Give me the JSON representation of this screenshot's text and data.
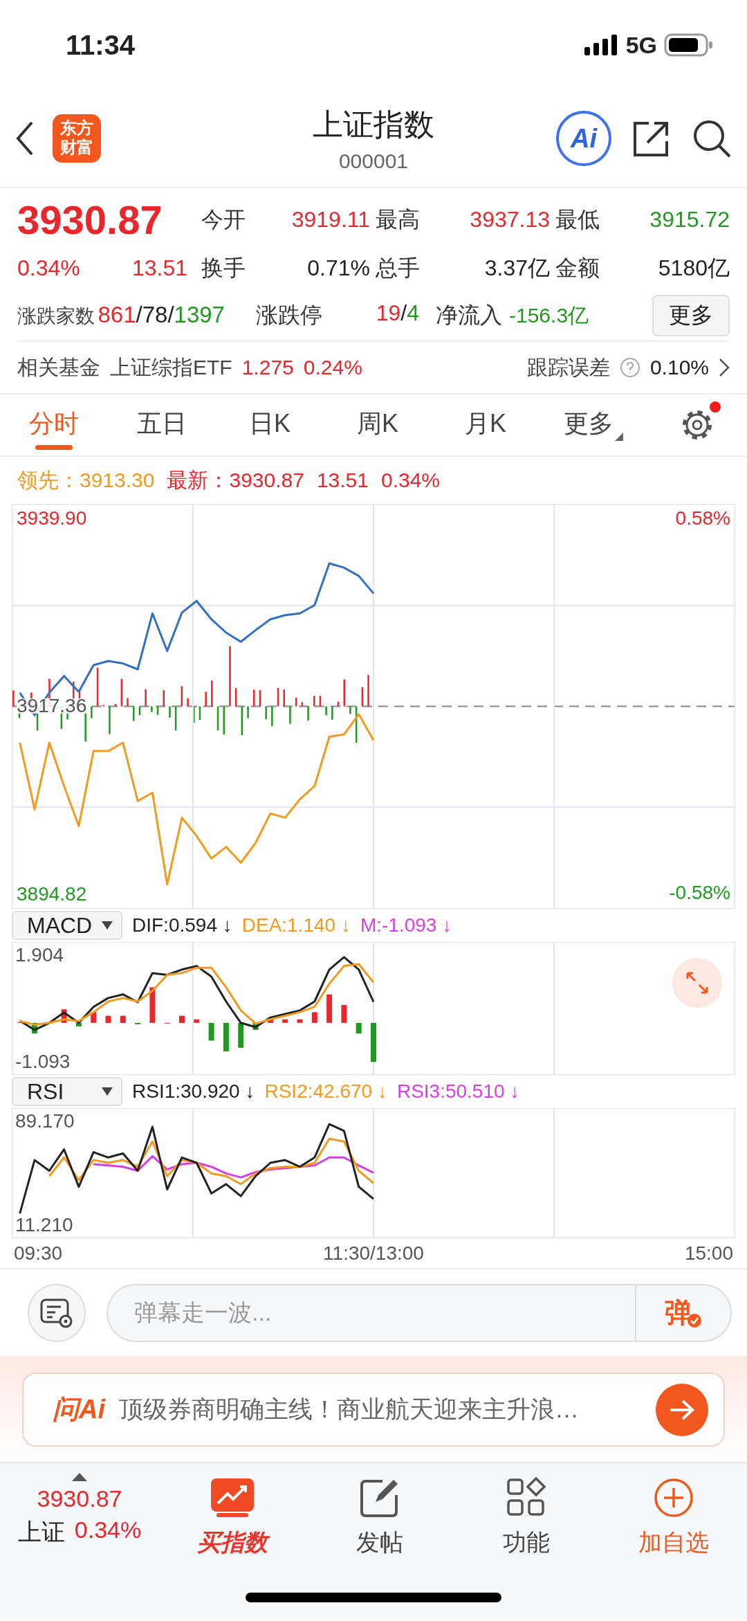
{
  "status_bar": {
    "time": "11:34",
    "network": "5G"
  },
  "header": {
    "logo": "东方财富",
    "title": "上证指数",
    "code": "000001",
    "ai_label": "Ai"
  },
  "quote": {
    "price": "3930.87",
    "change_pct": "0.34%",
    "change": "13.51",
    "color": "#e8262b",
    "stats": [
      {
        "label": "今开",
        "value": "3919.11",
        "color": "#e8262b"
      },
      {
        "label": "最高",
        "value": "3937.13",
        "color": "#e8262b"
      },
      {
        "label": "最低",
        "value": "3915.72",
        "color": "#1f9a1f"
      },
      {
        "label": "换手",
        "value": "0.71%",
        "color": "#222222"
      },
      {
        "label": "总手",
        "value": "3.37亿",
        "color": "#222222"
      },
      {
        "label": "金额",
        "value": "5180亿",
        "color": "#222222"
      }
    ],
    "breadth": {
      "label": "涨跌家数",
      "parts": [
        {
          "text": "861",
          "color": "#e8262b"
        },
        {
          "text": "/78/",
          "color": "#222222"
        },
        {
          "text": "1397",
          "color": "#1f9a1f"
        }
      ]
    },
    "limit": {
      "label": "涨跌停",
      "parts": [
        {
          "text": "19",
          "color": "#e8262b"
        },
        {
          "text": "/",
          "color": "#222222"
        },
        {
          "text": "4",
          "color": "#1f9a1f"
        }
      ]
    },
    "net_inflow": {
      "label": "净流入",
      "value": "-156.3亿",
      "color": "#1f9a1f"
    },
    "more_button": "更多"
  },
  "fund": {
    "label": "相关基金",
    "name": "上证综指ETF",
    "price": "1.275",
    "change": "0.24%",
    "tracking_label": "跟踪误差",
    "tracking_value": "0.10%"
  },
  "tabs": [
    {
      "label": "分时",
      "selected": true,
      "kind": "tab"
    },
    {
      "label": "五日",
      "selected": false,
      "kind": "tab"
    },
    {
      "label": "日K",
      "selected": false,
      "kind": "tab"
    },
    {
      "label": "周K",
      "selected": false,
      "kind": "tab"
    },
    {
      "label": "月K",
      "selected": false,
      "kind": "tab"
    },
    {
      "label": "更多",
      "selected": false,
      "kind": "menu"
    }
  ],
  "settings": {
    "notification_dot": true
  },
  "legend": [
    {
      "text": "领先：3913.30",
      "color": "#f39a1e"
    },
    {
      "text": "最新：3930.87",
      "color": "#e8262b"
    },
    {
      "text": "13.51",
      "color": "#e8262b"
    },
    {
      "text": "0.34%",
      "color": "#e8262b"
    }
  ],
  "price_chart": {
    "right_labels": [
      {
        "text": "0.58%",
        "color": "#e8262b"
      },
      {
        "text": "-0.58%",
        "color": "#1f9a1f"
      }
    ],
    "chart_data": {
      "type": "line",
      "categories": [
        null,
        null,
        null,
        null,
        null,
        null,
        null,
        null,
        null,
        null,
        null,
        null,
        null,
        null,
        null,
        null,
        null,
        null,
        null,
        null,
        null,
        null,
        null,
        null,
        null,
        null,
        null,
        null,
        null,
        null,
        null,
        null,
        null,
        null,
        null,
        null,
        null,
        null,
        null,
        null,
        null,
        null,
        null,
        null,
        null,
        null,
        null,
        null,
        null
      ],
      "series": [
        {
          "color": "#3370c4",
          "values": [
            3919.0,
            3916.3,
            3919.0,
            3921.0,
            3919.1,
            3922.3,
            3922.8,
            3922.5,
            3921.8,
            3928.5,
            3924.0,
            3928.6,
            3930.0,
            3927.8,
            3926.2,
            3925.1,
            3926.5,
            3927.8,
            3928.3,
            3928.5,
            3929.5,
            3934.5,
            3934.0,
            3933.0,
            3930.9,
            null,
            null,
            null,
            null,
            null,
            null,
            null,
            null,
            null,
            null,
            null,
            null,
            null,
            null,
            null,
            null,
            null,
            null,
            null,
            null,
            null,
            null,
            null,
            null
          ]
        },
        {
          "color": "#f39a1e",
          "values": [
            3913.0,
            3905.0,
            3913.0,
            3907.8,
            3903.0,
            3912.0,
            3912.0,
            3913.0,
            3906.0,
            3907.0,
            3896.0,
            3904.0,
            3901.8,
            3899.1,
            3900.5,
            3898.6,
            3901.0,
            3904.5,
            3904.0,
            3906.2,
            3907.8,
            3913.7,
            3914.0,
            3916.4,
            3913.3,
            null,
            null,
            null,
            null,
            null,
            null,
            null,
            null,
            null,
            null,
            null,
            null,
            null,
            null,
            null,
            null,
            null,
            null,
            null,
            null,
            null,
            null,
            null,
            null
          ]
        }
      ],
      "ylim": [
        3893.16,
        3941.56
      ],
      "grid": true,
      "yticks": [
        {
          "value": 3894.82,
          "label": "3894.82"
        },
        {
          "value": 3917.36,
          "label": "3917.36"
        },
        {
          "value": 3939.9,
          "label": "3939.90"
        }
      ]
    }
  },
  "macd": {
    "selector": "MACD",
    "readouts": [
      {
        "text": "DIF:0.594 ↓",
        "color": "#222222"
      },
      {
        "text": "DEA:1.140 ↓",
        "color": "#f39a1e"
      },
      {
        "text": "M:-1.093 ↓",
        "color": "#d83ee0"
      }
    ],
    "chart_data": {
      "type": "line",
      "categories": [
        null,
        null,
        null,
        null,
        null,
        null,
        null,
        null,
        null,
        null,
        null,
        null,
        null,
        null,
        null,
        null,
        null,
        null,
        null,
        null,
        null,
        null,
        null,
        null,
        null,
        null,
        null,
        null,
        null,
        null,
        null,
        null,
        null,
        null,
        null,
        null,
        null,
        null,
        null,
        null,
        null,
        null,
        null,
        null,
        null,
        null,
        null,
        null,
        null
      ],
      "series": [
        {
          "color": "#222222",
          "values": [
            0.06,
            -0.2,
            0.0,
            0.29,
            0.0,
            0.45,
            0.7,
            0.8,
            0.58,
            1.4,
            1.35,
            1.5,
            1.6,
            1.3,
            0.6,
            0.0,
            -0.12,
            0.15,
            0.25,
            0.35,
            0.6,
            1.5,
            1.85,
            1.5,
            0.59,
            null,
            null,
            null,
            null,
            null,
            null,
            null,
            null,
            null,
            null,
            null,
            null,
            null,
            null,
            null,
            null,
            null,
            null,
            null,
            null,
            null,
            null,
            null,
            null
          ]
        },
        {
          "color": "#f39a1e",
          "values": [
            0.05,
            -0.05,
            0.0,
            0.1,
            0.05,
            0.3,
            0.6,
            0.7,
            0.6,
            0.9,
            1.35,
            1.4,
            1.55,
            1.55,
            1.0,
            0.35,
            -0.02,
            0.1,
            0.2,
            0.3,
            0.45,
            1.1,
            1.6,
            1.65,
            1.14,
            null,
            null,
            null,
            null,
            null,
            null,
            null,
            null,
            null,
            null,
            null,
            null,
            null,
            null,
            null,
            null,
            null,
            null,
            null,
            null,
            null,
            null,
            null,
            null
          ]
        }
      ],
      "ylim": [
        -1.443,
        2.254
      ],
      "grid": true,
      "yticks": [
        {
          "value": -1.093,
          "label": "-1.093"
        },
        {
          "value": 1.904,
          "label": "1.904"
        }
      ]
    }
  },
  "rsi": {
    "selector": "RSI",
    "readouts": [
      {
        "text": "RSI1:30.920 ↓",
        "color": "#222222"
      },
      {
        "text": "RSI2:42.670 ↓",
        "color": "#f39a1e"
      },
      {
        "text": "RSI3:50.510 ↓",
        "color": "#d83ee0"
      }
    ],
    "chart_data": {
      "type": "line",
      "categories": [
        null,
        null,
        null,
        null,
        null,
        null,
        null,
        null,
        null,
        null,
        null,
        null,
        null,
        null,
        null,
        null,
        null,
        null,
        null,
        null,
        null,
        null,
        null,
        null,
        null,
        null,
        null,
        null,
        null,
        null,
        null,
        null,
        null,
        null,
        null,
        null,
        null,
        null,
        null,
        null,
        null,
        null,
        null,
        null,
        null,
        null,
        null,
        null,
        null
      ],
      "series": [
        {
          "color": "#d83ee0",
          "values": [
            null,
            null,
            null,
            null,
            null,
            57,
            56,
            55,
            52,
            63,
            53,
            57,
            58,
            55,
            50,
            47,
            51,
            53,
            54,
            55,
            56,
            62,
            62,
            56,
            50.5,
            null,
            null,
            null,
            null,
            null,
            null,
            null,
            null,
            null,
            null,
            null,
            null,
            null,
            null,
            null,
            null,
            null,
            null,
            null,
            null,
            null,
            null,
            null,
            null
          ]
        },
        {
          "color": "#f39a1e",
          "values": [
            null,
            null,
            48,
            62,
            45,
            60,
            58,
            60,
            55,
            74,
            48,
            60,
            58,
            50,
            48,
            42,
            50,
            54,
            55,
            55,
            58,
            76,
            74,
            52,
            42.7,
            null,
            null,
            null,
            null,
            null,
            null,
            null,
            null,
            null,
            null,
            null,
            null,
            null,
            null,
            null,
            null,
            null,
            null,
            null,
            null,
            null,
            null,
            null,
            null
          ]
        },
        {
          "color": "#222222",
          "values": [
            20,
            60,
            52,
            68,
            40,
            66,
            62,
            65,
            52,
            85,
            38,
            62,
            58,
            35,
            42,
            33,
            48,
            58,
            60,
            55,
            62,
            87,
            82,
            40,
            30.9,
            null,
            null,
            null,
            null,
            null,
            null,
            null,
            null,
            null,
            null,
            null,
            null,
            null,
            null,
            null,
            null,
            null,
            null,
            null,
            null,
            null,
            null,
            null,
            null
          ]
        }
      ],
      "ylim": [
        1.86,
        98.52
      ],
      "grid": true,
      "yticks": [
        {
          "value": 11.21,
          "label": "11.210"
        },
        {
          "value": 89.17,
          "label": "89.170"
        }
      ]
    }
  },
  "time_axis": [
    "09:30",
    "11:30/13:00",
    "15:00"
  ],
  "comment": {
    "placeholder": "弹幕走一波...",
    "send_label": "弹"
  },
  "ai_banner": {
    "logo": "问Ai",
    "text": "顶级券商明确主线！商业航天迎来主升浪…"
  },
  "bottom_nav": {
    "index": {
      "price": "3930.87",
      "name": "上证",
      "change": "0.34%",
      "color": "#e8262b"
    },
    "items": [
      {
        "label": "买指数",
        "kind": "buy"
      },
      {
        "label": "发帖",
        "kind": "post"
      },
      {
        "label": "功能",
        "kind": "apps"
      },
      {
        "label": "加自选",
        "kind": "add"
      }
    ]
  }
}
